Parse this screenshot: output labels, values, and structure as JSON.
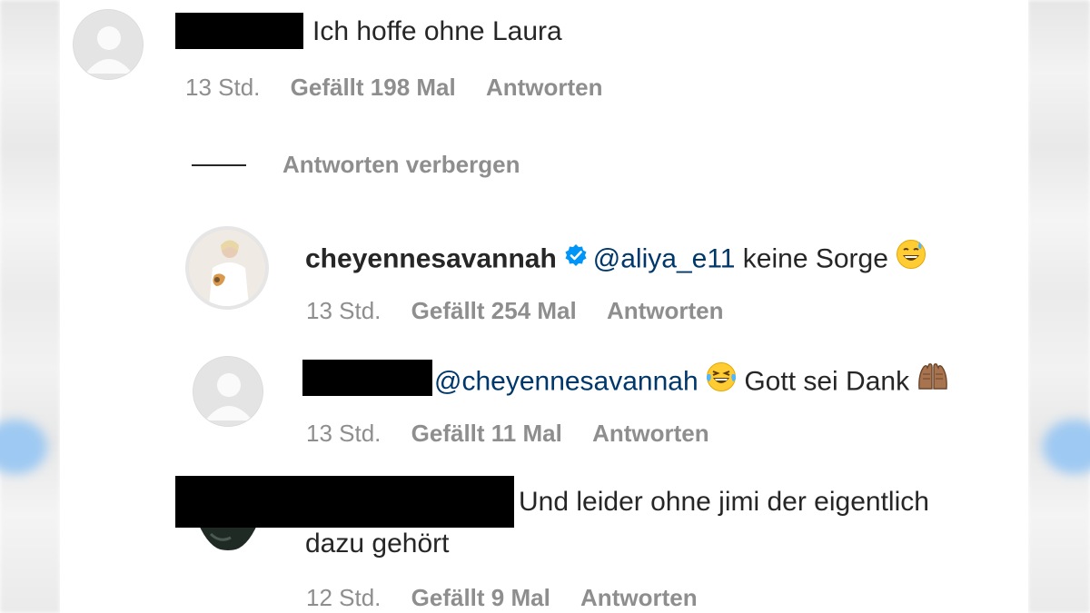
{
  "comments": [
    {
      "text": "Ich hoffe ohne Laura",
      "time": "13 Std.",
      "likes": "Gefällt 198 Mal",
      "reply": "Antworten"
    },
    {
      "username": "cheyennesavannah",
      "mention": "@aliya_e11",
      "text": " keine Sorge",
      "emoji": "sweat-smile-emoji",
      "time": "13 Std.",
      "likes": "Gefällt 254 Mal",
      "reply": "Antworten"
    },
    {
      "mention": "@cheyennesavannah",
      "emoji1": "laughing-tears-emoji",
      "text": " Gott sei Dank",
      "emoji2": "raising-hands-emoji",
      "time": "13 Std.",
      "likes": "Gefällt 11 Mal",
      "reply": "Antworten"
    },
    {
      "text_line1": "Und leider ohne jimi der eigentlich",
      "text_line2": "dazu gehört",
      "time": "12 Std.",
      "likes": "Gefällt 9 Mal",
      "reply": "Antworten"
    }
  ],
  "replies_toggle": "Antworten verbergen",
  "colors": {
    "text": "#262626",
    "meta": "#8e8e8e",
    "mention": "#00376b",
    "verified": "#0095f6"
  }
}
